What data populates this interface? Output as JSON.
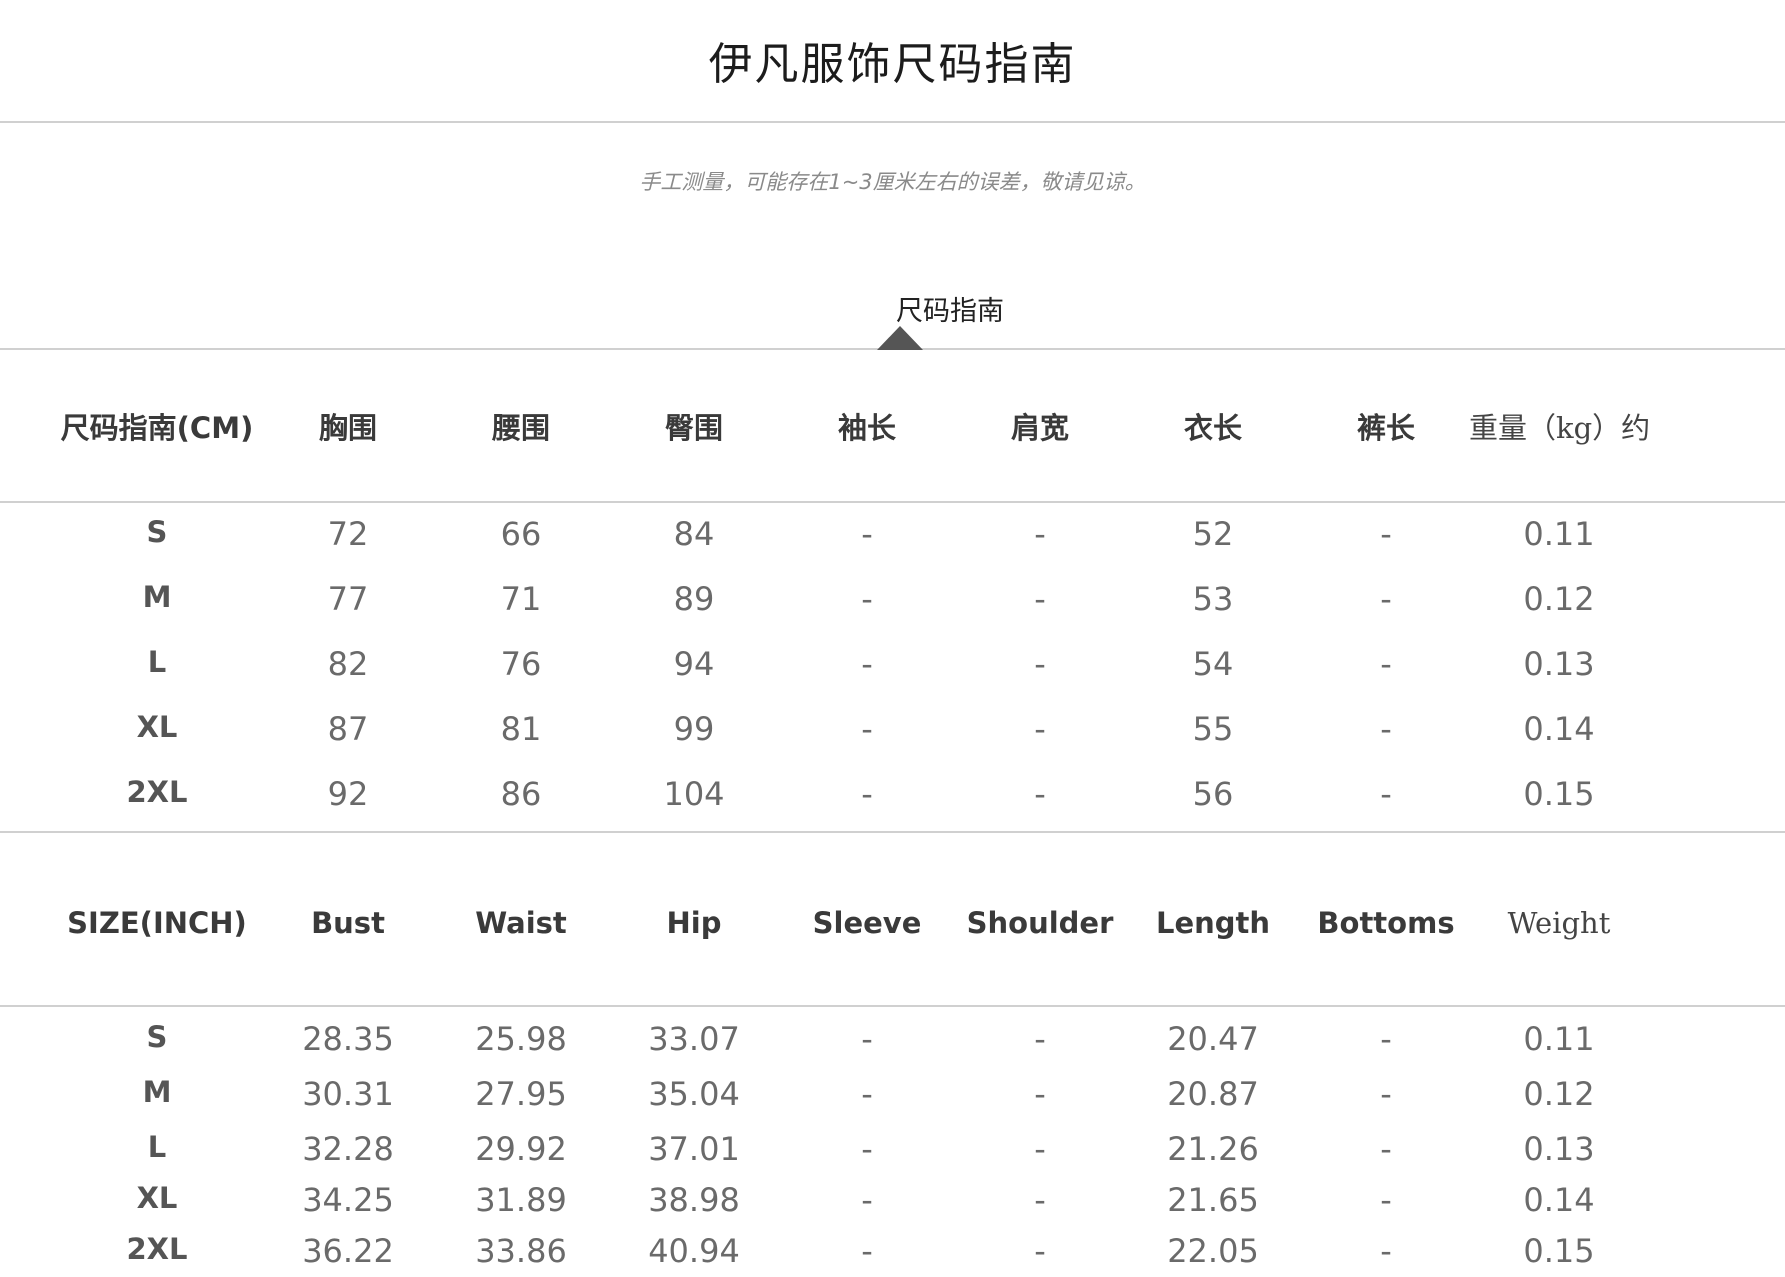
{
  "page": {
    "title": "伊凡服饰尺码指南",
    "note": "手工测量，可能存在1~3厘米左右的误差，敬请见谅。",
    "tab_label": "尺码指南"
  },
  "cm_table": {
    "headers": [
      "尺码指南(CM)",
      "胸围",
      "腰围",
      "臀围",
      "袖长",
      "肩宽",
      "衣长",
      "裤长",
      "重量（kg）约"
    ],
    "rows": [
      [
        "S",
        "72",
        "66",
        "84",
        "-",
        "-",
        "52",
        "-",
        "0.11"
      ],
      [
        "M",
        "77",
        "71",
        "89",
        "-",
        "-",
        "53",
        "-",
        "0.12"
      ],
      [
        "L",
        "82",
        "76",
        "94",
        "-",
        "-",
        "54",
        "-",
        "0.13"
      ],
      [
        "XL",
        "87",
        "81",
        "99",
        "-",
        "-",
        "55",
        "-",
        "0.14"
      ],
      [
        "2XL",
        "92",
        "86",
        "104",
        "-",
        "-",
        "56",
        "-",
        "0.15"
      ]
    ]
  },
  "inch_table": {
    "headers": [
      "SIZE(INCH)",
      "Bust",
      "Waist",
      "Hip",
      "Sleeve",
      "Shoulder",
      "Length",
      "Bottoms",
      "Weight"
    ],
    "rows": [
      [
        "S",
        "28.35",
        "25.98",
        "33.07",
        "-",
        "-",
        "20.47",
        "-",
        "0.11"
      ],
      [
        "M",
        "30.31",
        "27.95",
        "35.04",
        "-",
        "-",
        "20.87",
        "-",
        "0.12"
      ],
      [
        "L",
        "32.28",
        "29.92",
        "37.01",
        "-",
        "-",
        "21.26",
        "-",
        "0.13"
      ],
      [
        "XL",
        "34.25",
        "31.89",
        "38.98",
        "-",
        "-",
        "21.65",
        "-",
        "0.14"
      ],
      [
        "2XL",
        "36.22",
        "33.86",
        "40.94",
        "-",
        "-",
        "22.05",
        "-",
        "0.15"
      ]
    ]
  }
}
